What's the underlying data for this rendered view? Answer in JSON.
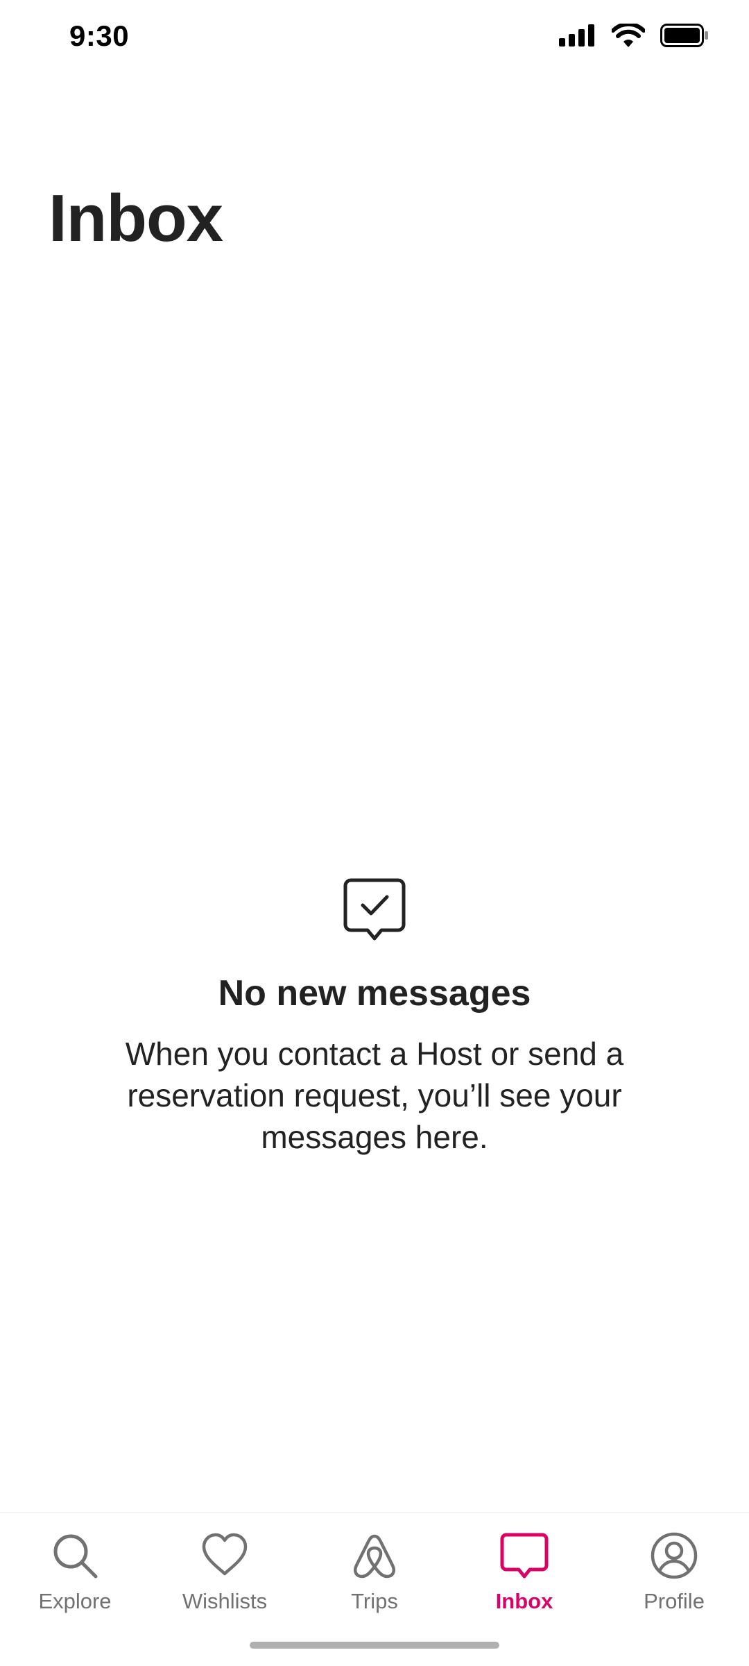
{
  "status_bar": {
    "time": "9:30",
    "icons": [
      "cellular-signal-icon",
      "wifi-icon",
      "battery-icon"
    ]
  },
  "page": {
    "title": "Inbox"
  },
  "empty_state": {
    "icon": "message-check-icon",
    "title": "No new messages",
    "body": "When you contact a Host or send a reservation request, you’ll see your messages here."
  },
  "tab_bar": {
    "active_color": "#d70466",
    "inactive_color": "#717171",
    "tabs": [
      {
        "label": "Explore",
        "icon": "search-icon",
        "active": false
      },
      {
        "label": "Wishlists",
        "icon": "heart-icon",
        "active": false
      },
      {
        "label": "Trips",
        "icon": "airbnb-logo-icon",
        "active": false
      },
      {
        "label": "Inbox",
        "icon": "message-icon",
        "active": true
      },
      {
        "label": "Profile",
        "icon": "user-circle-icon",
        "active": false
      }
    ]
  }
}
